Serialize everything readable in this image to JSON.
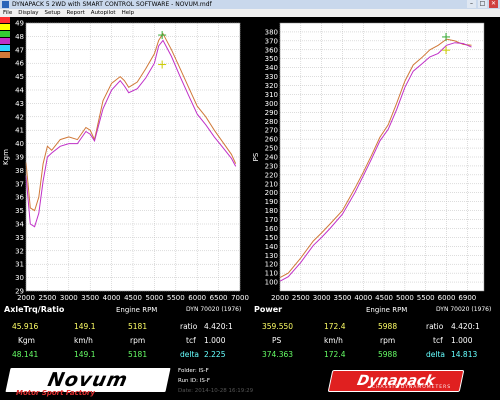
{
  "window": {
    "title": "DYNAPACK 5 2WD with SMART CONTROL SOFTWARE - NOVUM.mdf"
  },
  "menu": [
    "File",
    "Display",
    "Setup",
    "Report",
    "Autopilot",
    "Help"
  ],
  "colors": {
    "background": "#000000",
    "plot_background": "#ffffff",
    "series_1": "#d07838",
    "series_2": "#c030c8",
    "legend_swatches": [
      "#ff3030",
      "#ffff00",
      "#33cc33",
      "#c030c8",
      "#30d0ff",
      "#d07838"
    ]
  },
  "chart_data": [
    {
      "type": "line",
      "name": "AxleTrq/Ratio",
      "xlabel": "Engine RPM",
      "ylabel": "Kgm",
      "dyn": "DYN 70020 (1976)",
      "xlim": [
        2000,
        7000
      ],
      "ylim": [
        29,
        49
      ],
      "x_ticks": [
        2000,
        2500,
        3000,
        3500,
        4000,
        4500,
        5000,
        5500,
        6000,
        6500,
        7000
      ],
      "y_ticks": [
        29,
        30,
        31,
        32,
        33,
        34,
        35,
        36,
        37,
        38,
        39,
        40,
        41,
        42,
        43,
        44,
        45,
        46,
        47,
        48,
        49
      ],
      "grid": true,
      "series": [
        {
          "x": [
            2000,
            2100,
            2200,
            2300,
            2400,
            2500,
            2600,
            2800,
            3000,
            3200,
            3400,
            3500,
            3600,
            3800,
            4000,
            4200,
            4300,
            4400,
            4600,
            4800,
            5000,
            5100,
            5200,
            5400,
            5600,
            5800,
            6000,
            6200,
            6400,
            6600,
            6800,
            6900
          ],
          "y": [
            38.6,
            35.2,
            35.0,
            36.0,
            38.5,
            39.8,
            39.5,
            40.3,
            40.5,
            40.3,
            41.2,
            41.0,
            40.3,
            43.2,
            44.5,
            45.0,
            44.7,
            44.2,
            44.6,
            45.6,
            46.7,
            47.7,
            48.2,
            47.0,
            45.6,
            44.2,
            42.8,
            42.0,
            41.0,
            40.1,
            39.2,
            38.5
          ]
        },
        {
          "x": [
            2000,
            2100,
            2200,
            2300,
            2400,
            2500,
            2600,
            2800,
            3000,
            3200,
            3400,
            3500,
            3600,
            3800,
            4000,
            4200,
            4300,
            4400,
            4600,
            4800,
            5000,
            5100,
            5200,
            5400,
            5600,
            5800,
            6000,
            6200,
            6400,
            6600,
            6800,
            6900
          ],
          "y": [
            37.6,
            34.0,
            33.8,
            34.8,
            37.2,
            39.0,
            39.3,
            39.8,
            40.0,
            40.0,
            40.9,
            40.7,
            40.2,
            42.6,
            44.0,
            44.7,
            44.3,
            43.8,
            44.1,
            44.9,
            46.0,
            47.3,
            47.7,
            46.5,
            45.0,
            43.6,
            42.2,
            41.4,
            40.5,
            39.7,
            38.9,
            38.3
          ]
        }
      ],
      "markers": [
        {
          "x": 5181,
          "y": 48.1
        },
        {
          "x": 5181,
          "y": 45.9
        }
      ]
    },
    {
      "type": "line",
      "name": "Power",
      "xlabel": "Engine RPM",
      "ylabel": "PS",
      "dyn": "DYN 70020 (1976)",
      "xlim": [
        2000,
        6900
      ],
      "ylim": [
        90,
        390
      ],
      "x_ticks": [
        2000,
        2500,
        3000,
        3500,
        4000,
        4500,
        5000,
        5500,
        6000,
        6500
      ],
      "x_tick_labels": [
        "2000",
        "2500",
        "3000",
        "3500",
        "4000",
        "4500",
        "5000",
        "5500",
        "6000",
        "6900"
      ],
      "y_ticks": [
        100,
        110,
        120,
        130,
        140,
        150,
        160,
        170,
        180,
        190,
        200,
        210,
        220,
        230,
        240,
        250,
        260,
        270,
        280,
        290,
        300,
        310,
        320,
        330,
        340,
        350,
        360,
        370,
        380
      ],
      "grid": true,
      "series": [
        {
          "x": [
            2000,
            2200,
            2500,
            2800,
            3000,
            3200,
            3500,
            3800,
            4000,
            4200,
            4400,
            4600,
            4800,
            5000,
            5200,
            5400,
            5600,
            5800,
            6000,
            6200,
            6400,
            6600
          ],
          "y": [
            105,
            110,
            127,
            146,
            155,
            165,
            180,
            205,
            223,
            242,
            262,
            276,
            300,
            325,
            343,
            351,
            360,
            365,
            372,
            370,
            366,
            365
          ]
        },
        {
          "x": [
            2000,
            2200,
            2500,
            2800,
            3000,
            3200,
            3500,
            3800,
            4000,
            4200,
            4400,
            4600,
            4800,
            5000,
            5200,
            5400,
            5600,
            5800,
            6000,
            6200,
            6400,
            6600
          ],
          "y": [
            101,
            106,
            122,
            141,
            150,
            160,
            176,
            200,
            219,
            238,
            258,
            271,
            293,
            318,
            336,
            344,
            352,
            356,
            365,
            368,
            367,
            363
          ]
        }
      ],
      "markers": [
        {
          "x": 5988,
          "y": 374.4
        },
        {
          "x": 5988,
          "y": 359.6
        }
      ]
    }
  ],
  "readouts": {
    "left": {
      "row1": {
        "v1": "45.916",
        "v2": "149.1",
        "v3": "5181",
        "label": "ratio",
        "value": "4.420:1"
      },
      "units": {
        "u1": "Kgm",
        "u2": "km/h",
        "u3": "rpm",
        "label": "tcf",
        "value": "1.000"
      },
      "row2": {
        "v1": "48.141",
        "v2": "149.1",
        "v3": "5181",
        "label": "delta",
        "value": "2.225"
      }
    },
    "right": {
      "row1": {
        "v1": "359.550",
        "v2": "172.4",
        "v3": "5988",
        "label": "ratio",
        "value": "4.420:1"
      },
      "units": {
        "u1": "PS",
        "u2": "km/h",
        "u3": "rpm",
        "label": "tcf",
        "value": "1.000"
      },
      "row2": {
        "v1": "374.363",
        "v2": "172.4",
        "v3": "5988",
        "label": "delta",
        "value": "14.813"
      }
    }
  },
  "footer": {
    "folder": "Folder:  IS-F",
    "runid": "Run ID:  IS-F",
    "date": "Date:    2014-10-28 16:19:29",
    "novum_logo": "Novum",
    "novum_tagline": "Motor Sport Factory",
    "dyna_logo": "Dynapack",
    "dyna_tagline": "CHASSIS DYNAMOMETERS"
  }
}
